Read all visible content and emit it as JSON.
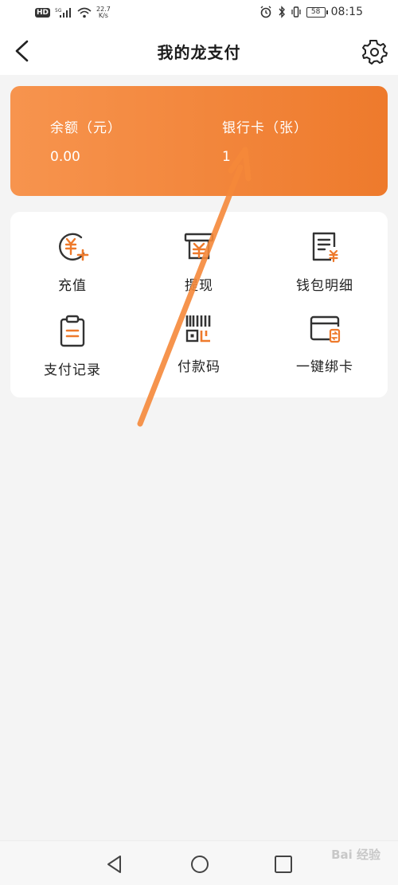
{
  "status_bar": {
    "left_badge": "HD",
    "network_speed": "22.7",
    "network_unit": "K/s",
    "battery": "58",
    "time": "08:15"
  },
  "header": {
    "title": "我的龙支付"
  },
  "balance_card": {
    "balance_label": "余额（元）",
    "balance_value": "0.00",
    "bank_card_label": "银行卡（张）",
    "bank_card_value": "1"
  },
  "functions": [
    {
      "label": "充值",
      "icon": "yuan-plus-icon"
    },
    {
      "label": "提现",
      "icon": "withdraw-icon"
    },
    {
      "label": "钱包明细",
      "icon": "wallet-detail-icon"
    },
    {
      "label": "支付记录",
      "icon": "clipboard-icon"
    },
    {
      "label": "付款码",
      "icon": "barcode-icon"
    },
    {
      "label": "一键绑卡",
      "icon": "bind-card-icon"
    }
  ],
  "colors": {
    "accent": "#ee7a2c",
    "card_start": "#f7944e",
    "icon_dark": "#333333",
    "arrow": "#f5883a"
  },
  "watermark": "Bai 经验"
}
